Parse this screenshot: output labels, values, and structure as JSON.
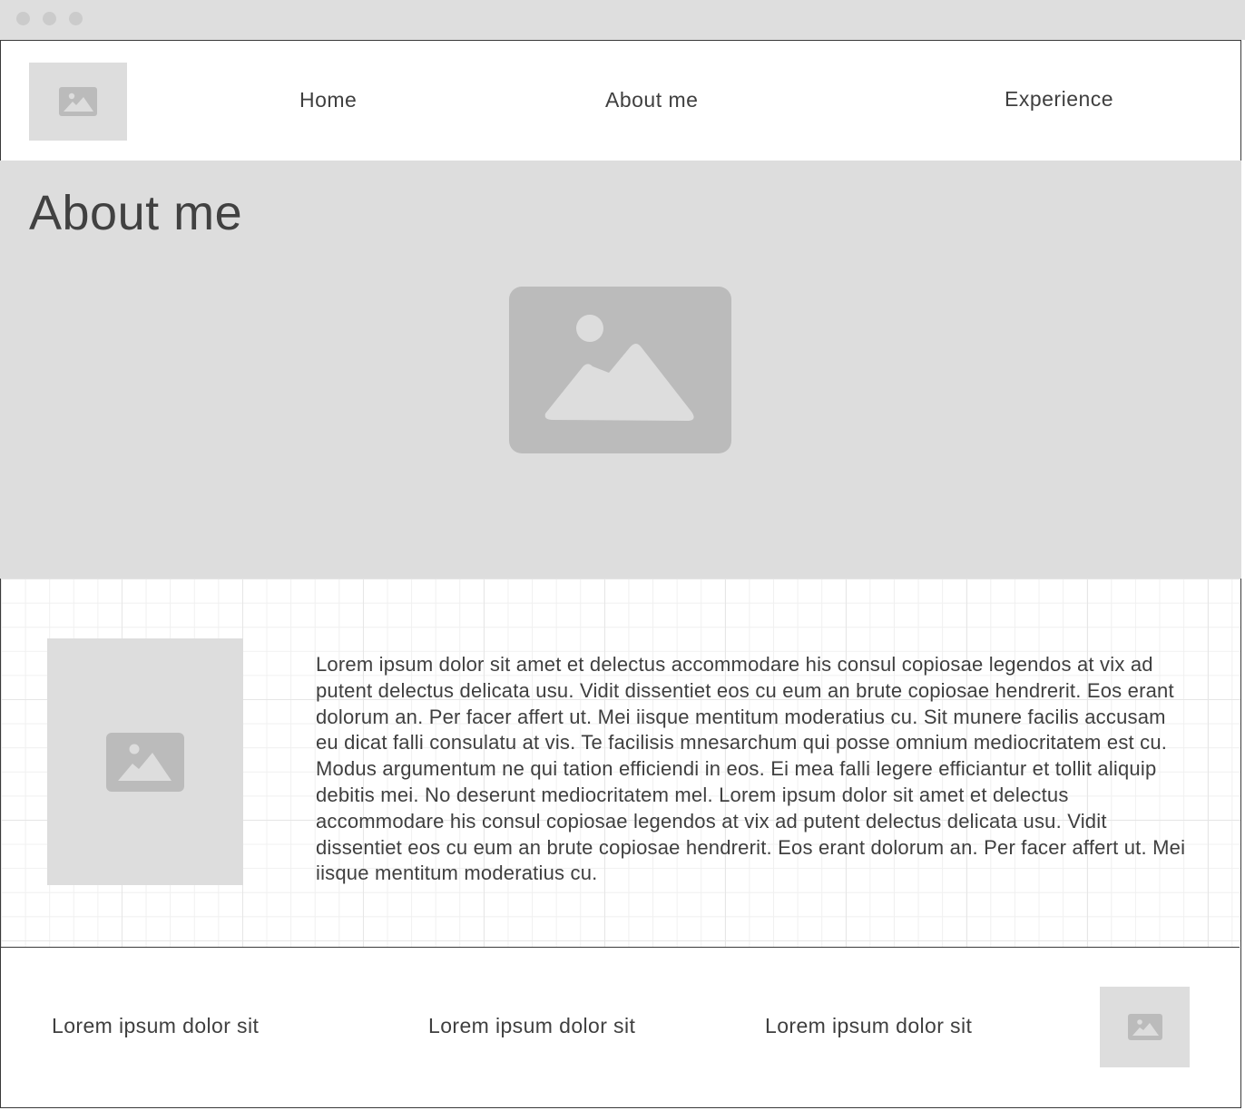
{
  "window": {
    "controls": [
      "close-dot",
      "minimize-dot",
      "maximize-dot"
    ]
  },
  "header": {
    "nav": [
      {
        "label": "Home"
      },
      {
        "label": "About me"
      },
      {
        "label": "Experience"
      }
    ]
  },
  "hero": {
    "title": "About me"
  },
  "main": {
    "paragraph": "Lorem ipsum dolor sit amet et delectus accommodare his consul copiosae legendos at vix ad putent delectus delicata usu. Vidit dissentiet eos cu eum an brute copiosae hendrerit. Eos erant dolorum an. Per facer affert ut. Mei iisque mentitum moderatius cu. Sit munere facilis accusam eu dicat falli consulatu at vis. Te facilisis mnesarchum qui posse omnium mediocritatem est cu. Modus argumentum ne qui tation efficiendi in eos. Ei mea falli legere efficiantur et tollit aliquip debitis mei. No deserunt mediocritatem mel. Lorem ipsum dolor sit amet et delectus accommodare his consul copiosae legendos at vix ad putent delectus delicata usu. Vidit dissentiet eos cu eum an brute copiosae hendrerit. Eos erant dolorum an. Per facer affert ut. Mei iisque mentitum moderatius cu."
  },
  "footer": {
    "links": [
      {
        "label": "Lorem ipsum dolor sit"
      },
      {
        "label": "Lorem ipsum dolor sit"
      },
      {
        "label": "Lorem ipsum dolor sit"
      }
    ]
  },
  "colors": {
    "placeholder": "#dddddd",
    "placeholder_icon": "#bbbbbb",
    "text": "#3f3f3f",
    "border": "#3a3a3a"
  }
}
